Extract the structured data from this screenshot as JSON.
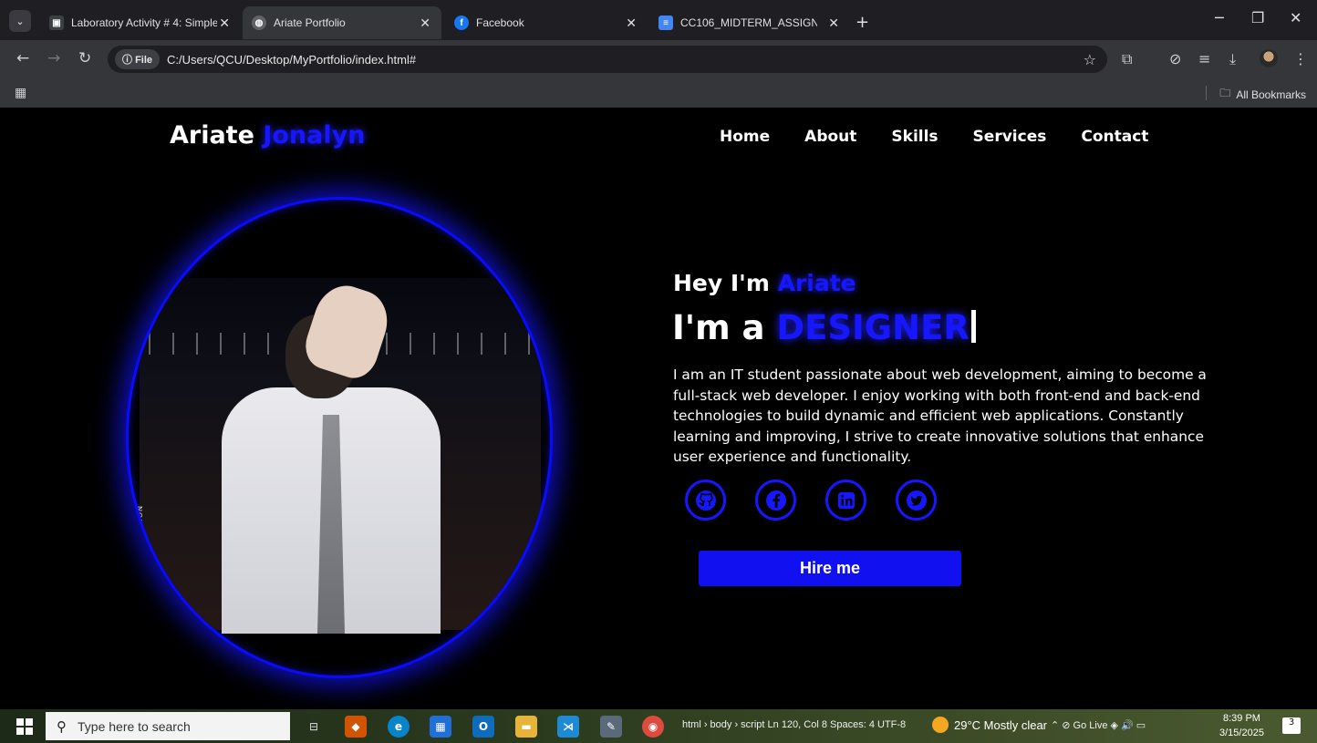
{
  "browser": {
    "tabs": [
      {
        "title": "Laboratory Activity # 4: Simple",
        "favicon": "classroom-icon",
        "favicon_color": "#3c4043"
      },
      {
        "title": "Ariate Portfolio",
        "favicon": "globe-icon",
        "favicon_color": "#5f6368"
      },
      {
        "title": "Facebook",
        "favicon": "facebook-icon",
        "favicon_color": "#1877f2"
      },
      {
        "title": "CC106_MIDTERM_ASSIGNMENT",
        "favicon": "docs-icon",
        "favicon_color": "#4285f4"
      }
    ],
    "new_tab": "+",
    "address": {
      "chip": "File",
      "url": "C:/Users/QCU/Desktop/MyPortfolio/index.html#"
    },
    "bookmarks": {
      "all_label": "All Bookmarks"
    }
  },
  "site": {
    "brand": {
      "first": "Ariate",
      "accent": "Jonalyn"
    },
    "nav": [
      "Home",
      "About",
      "Skills",
      "Services",
      "Contact"
    ],
    "hero": {
      "greeting": "Hey I'm",
      "greeting_name": "Ariate",
      "role_prefix": "I'm a",
      "role_word": "DESIGNER",
      "bio": "I am an IT student passionate about web development, aiming to become a full-stack web developer. I enjoy working with both front-end and back-end technologies to build dynamic and efficient web applications. Constantly learning and improving, I strive to create innovative solutions that enhance user experience and functionality.",
      "photo_side_text": "NOIT",
      "socials": [
        "github-icon",
        "facebook-icon",
        "linkedin-icon",
        "twitter-icon"
      ],
      "cta": "Hire me"
    },
    "colors": {
      "accent": "#1616ff",
      "background": "#000000"
    }
  },
  "taskbar": {
    "search_placeholder": "Type here to search",
    "status": "html › body › script   Ln 120, Col 8   Spaces: 4   UTF-8",
    "weather": "29°C  Mostly clear",
    "tray_text": "Go Live",
    "time": "8:39 PM",
    "date": "3/15/2025",
    "notifications": "3"
  }
}
